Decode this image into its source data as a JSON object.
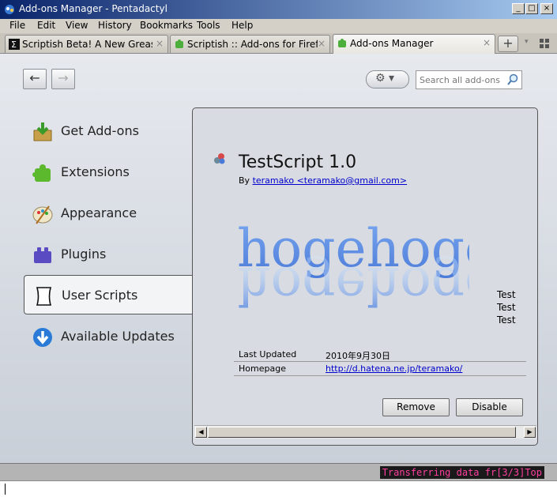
{
  "window": {
    "title": "Add-ons Manager - Pentadactyl",
    "controls": [
      "_",
      "□",
      "×"
    ]
  },
  "menu": [
    "File",
    "Edit",
    "View",
    "History",
    "Bookmarks",
    "Tools",
    "Help"
  ],
  "tabs": [
    {
      "label": "Scriptish Beta! A New Greas…",
      "close": "×"
    },
    {
      "label": "Scriptish :: Add-ons for Firefox",
      "close": "×"
    },
    {
      "label": "Add-ons Manager",
      "close": "×"
    }
  ],
  "toolbar": {
    "new_tab": "+",
    "back": "←",
    "forward": "→",
    "gear": "⚙ ▾",
    "search_placeholder": "Search all add-ons"
  },
  "categories": [
    {
      "label": "Get Add-ons",
      "icon": "get-addons-icon"
    },
    {
      "label": "Extensions",
      "icon": "puzzle-icon"
    },
    {
      "label": "Appearance",
      "icon": "palette-icon"
    },
    {
      "label": "Plugins",
      "icon": "plugin-icon"
    },
    {
      "label": "User Scripts",
      "icon": "script-icon"
    },
    {
      "label": "Available Updates",
      "icon": "update-icon"
    }
  ],
  "addon": {
    "name": "TestScript",
    "version": "1.0",
    "by_label": "By",
    "author": "teramako <teramako@gmail.com>",
    "preview_text": "hogehoge",
    "test_lines": [
      "Test",
      "Test",
      "Test"
    ],
    "details": [
      {
        "key": "Last Updated",
        "value": "2010年9月30日",
        "link": false
      },
      {
        "key": "Homepage",
        "value": "http://d.hatena.ne.jp/teramako/",
        "link": true
      }
    ],
    "remove_label": "Remove",
    "disable_label": "Disable"
  },
  "status": {
    "text": "Transferring data fr[3/3]Top"
  },
  "colors": {
    "status_fg": "#ff3fa0",
    "status_bg": "#1a1a1a",
    "link": "#0000cc",
    "titlebar": "#0a246a"
  }
}
